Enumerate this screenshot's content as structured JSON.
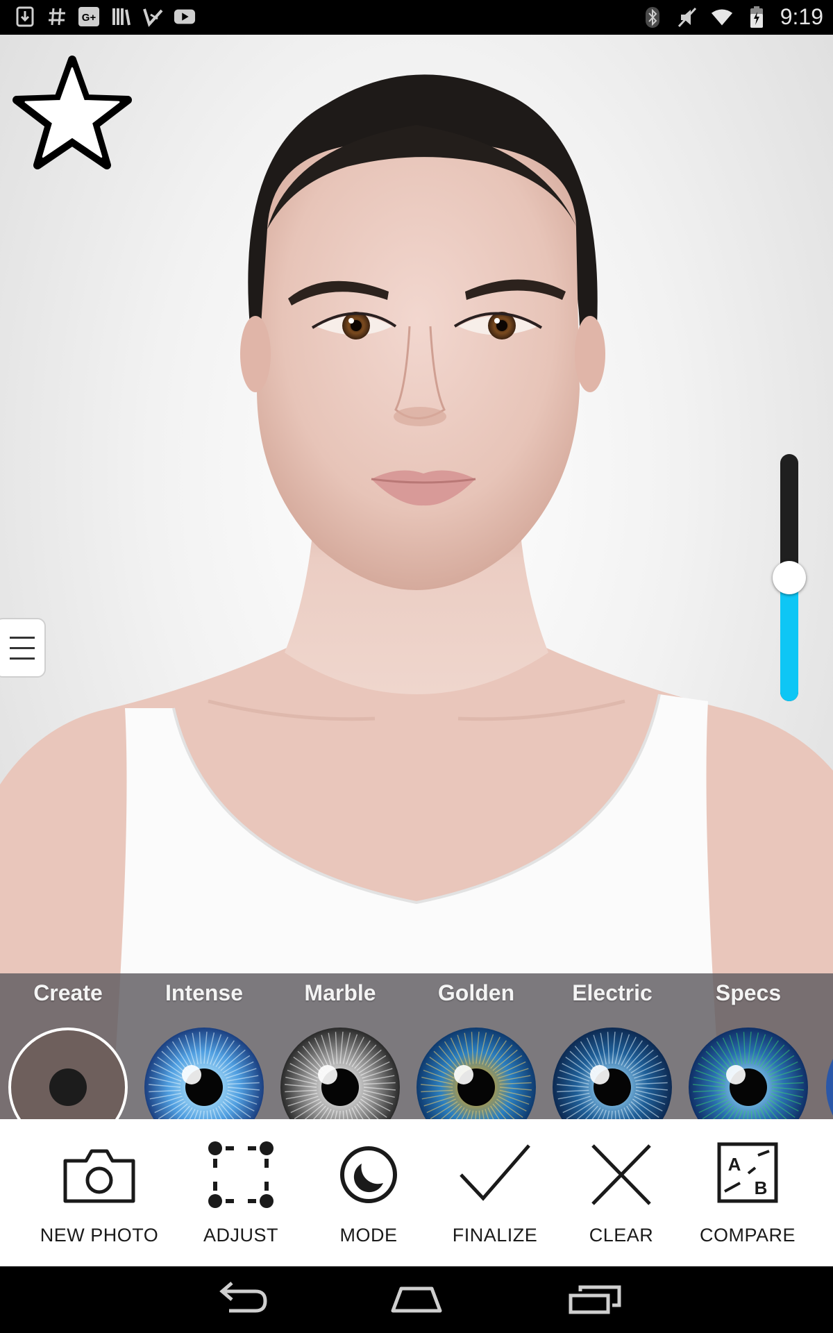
{
  "status_bar": {
    "time": "9:19",
    "left_icons": [
      "download-icon",
      "hashtag-icon",
      "google-plus-icon",
      "library-icon",
      "play-store-icon",
      "youtube-icon"
    ],
    "right_icons": [
      "bluetooth-icon",
      "mute-icon",
      "wifi-icon",
      "battery-icon"
    ]
  },
  "photo": {
    "favorite_icon": "star-outline-icon",
    "menu_icon": "hamburger-icon",
    "intensity": 0.5
  },
  "lenses": [
    {
      "label": "Create",
      "style": "create",
      "selected": true
    },
    {
      "label": "Intense",
      "style": "intense"
    },
    {
      "label": "Marble",
      "style": "marble"
    },
    {
      "label": "Golden",
      "style": "golden"
    },
    {
      "label": "Electric",
      "style": "electric"
    },
    {
      "label": "Specs",
      "style": "specs"
    }
  ],
  "toolbar": {
    "new_photo": "NEW PHOTO",
    "adjust": "ADJUST",
    "mode": "MODE",
    "finalize": "FINALIZE",
    "clear": "CLEAR",
    "compare": "COMPARE",
    "compare_icon_a": "A",
    "compare_icon_b": "B"
  },
  "nav": {
    "back_icon": "back-icon",
    "home_icon": "home-icon",
    "recents_icon": "recents-icon"
  },
  "colors": {
    "slider_fill": "#0ec6f5",
    "slider_track": "#1f1f1f",
    "strip_bg": "#5f5c60"
  }
}
